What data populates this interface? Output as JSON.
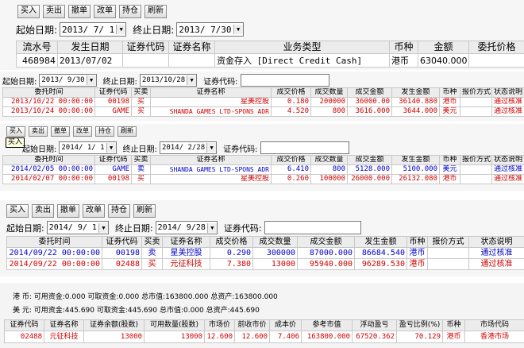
{
  "toolbar": {
    "buy": "买入",
    "sell": "卖出",
    "cancel": "撤单",
    "modify": "改单",
    "hold": "持仓",
    "refresh": "刷新"
  },
  "tooltip": "买入",
  "labels": {
    "start_date": "起始日期:",
    "end_date": "终止日期:",
    "code": "证券代码:",
    "start_date_typo": "起始日期:"
  },
  "p1": {
    "start": "2013/ 7/ 1",
    "end": "2013/ 7/30",
    "headers": [
      "流水号",
      "发生日期",
      "证券代码",
      "证券名称",
      "业务类型",
      "币种",
      "金额",
      "委托价格"
    ],
    "rows": [
      [
        "468984",
        "2013/07/02",
        "",
        "",
        "资金存入 [Direct Credit Cash]",
        "港币",
        "63040.000",
        ""
      ]
    ]
  },
  "p2": {
    "start": "2013/ 9/30",
    "end": "2013/10/28",
    "headers": [
      "委托时间",
      "证券代码",
      "买卖",
      "证券名称",
      "成交价格",
      "成交数量",
      "成交金额",
      "发生金额",
      "币种",
      "报价方式",
      "状态说明"
    ],
    "rows": [
      [
        "2013/10/22 00:00:00",
        "00198",
        "买",
        "星美控股",
        "0.180",
        "200000",
        "36000.00",
        "36140.880",
        "港币",
        "",
        "通过核准"
      ],
      [
        "2013/10/24 00:00:00",
        "GAME",
        "买",
        "SHANDA GAMES LTD-SPONS ADR",
        "4.520",
        "800",
        "3616.000",
        "3644.000",
        "美元",
        "",
        "通过核准"
      ]
    ]
  },
  "p3": {
    "start": "2014/ 1/ 1",
    "end": "2014/ 2/28",
    "headers": [
      "委托时间",
      "证券代码",
      "买卖",
      "证券名称",
      "成交价格",
      "成交数量",
      "成交金额",
      "发生金额",
      "币种",
      "报价方式",
      "状态说明"
    ],
    "rows": [
      [
        "2014/02/05 00:00:00",
        "GAME",
        "卖",
        "SHANDA GAMES LTD-SPONS ADR",
        "6.410",
        "800",
        "5128.000",
        "5100.000",
        "美元",
        "",
        "通过核准"
      ],
      [
        "2014/02/07 00:00:00",
        "00198",
        "买",
        "星美控股",
        "0.260",
        "100000",
        "26000.000",
        "26132.080",
        "港币",
        "",
        "通过核准"
      ]
    ]
  },
  "p4": {
    "start": "2014/ 9/ 1",
    "end": "2014/ 9/28",
    "headers": [
      "委托时间",
      "证券代码",
      "买卖",
      "证券名称",
      "成交价格",
      "成交数量",
      "成交金额",
      "发生金额",
      "币种",
      "报价方式",
      "状态说明"
    ],
    "rows": [
      [
        "2014/09/22 00:00:00",
        "00198",
        "卖",
        "星美控股",
        "0.290",
        "300000",
        "87000.000",
        "86684.540",
        "港币",
        "",
        "通过核准"
      ],
      [
        "2014/09/22 00:00:00",
        "02488",
        "买",
        "元征科技",
        "7.380",
        "13000",
        "95940.000",
        "96289.530",
        "港币",
        "",
        "通过核准"
      ]
    ]
  },
  "p5": {
    "summary": [
      "港    币: 可用资金:0.000   可取资金:0.000   总市值:163800.000  总资产:163800.000",
      "美    元: 可用资金:445.690  可取资金:445.690  总市值:0.000   总资产:445.690"
    ],
    "headers": [
      "证券代码",
      "证券名称",
      "证券余额(股数)",
      "可用数量(股数)",
      "市场价",
      "前收市价",
      "成本价",
      "参考市值",
      "浮动盈亏",
      "盈亏比例(%)",
      "币种",
      "市场代码"
    ],
    "rows": [
      [
        "02488",
        "元征科技",
        "13000",
        "13000",
        "12.600",
        "12.600",
        "7.406",
        "163800.000",
        "67520.362",
        "70.129",
        "港币",
        "香港市场"
      ]
    ]
  }
}
